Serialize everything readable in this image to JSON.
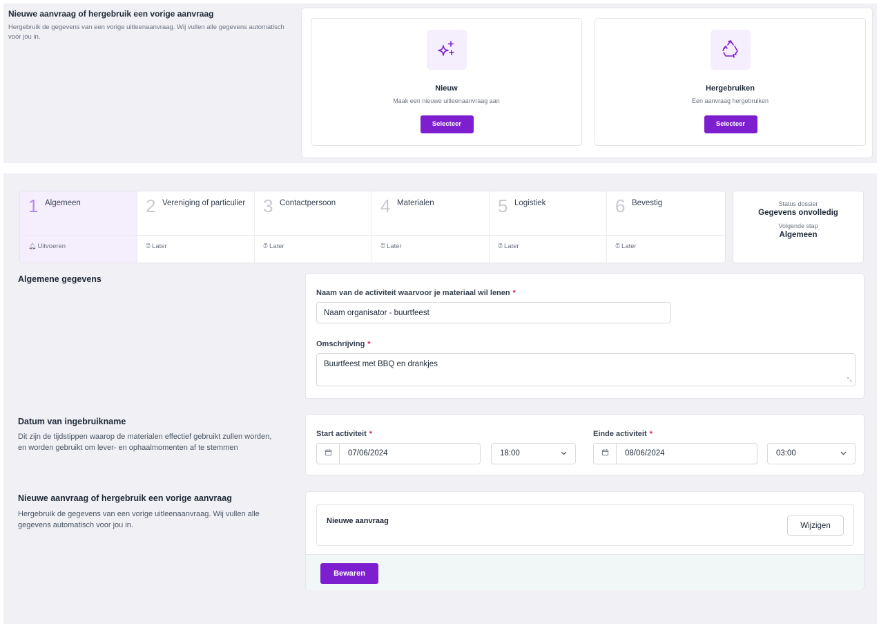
{
  "top": {
    "title": "Nieuwe aanvraag of hergebruik een vorige aanvraag",
    "description": "Hergebruik de gegevens van een vorige uitleenaanvraag. Wij vullen alle gegevens automatisch voor jou in.",
    "choices": [
      {
        "icon": "sparkles-icon",
        "title": "Nieuw",
        "subtitle": "Maak een nieuwe uitleenaanvraag aan",
        "button": "Selecteer"
      },
      {
        "icon": "recycle-icon",
        "title": "Hergebruiken",
        "subtitle": "Een aanvraag hergebruiken",
        "button": "Selecteer"
      }
    ]
  },
  "stepper": {
    "steps": [
      {
        "num": "1",
        "label": "Algemeen",
        "state": "Uitvoeren",
        "state_icon": "bell-icon",
        "active": true
      },
      {
        "num": "2",
        "label": "Vereniging of particulier",
        "state": "Later",
        "state_icon": "alarm-icon",
        "active": false
      },
      {
        "num": "3",
        "label": "Contactpersoon",
        "state": "Later",
        "state_icon": "alarm-icon",
        "active": false
      },
      {
        "num": "4",
        "label": "Materialen",
        "state": "Later",
        "state_icon": "alarm-icon",
        "active": false
      },
      {
        "num": "5",
        "label": "Logistiek",
        "state": "Later",
        "state_icon": "alarm-icon",
        "active": false
      },
      {
        "num": "6",
        "label": "Bevestig",
        "state": "Later",
        "state_icon": "alarm-icon",
        "active": false
      }
    ]
  },
  "status": {
    "label": "Status dossier",
    "value": "Gegevens onvolledig",
    "next_label": "Volgende stap",
    "next_value": "Algemeen"
  },
  "general": {
    "title": "Algemene gegevens",
    "name_label": "Naam van de activiteit waarvoor je materiaal wil lenen",
    "name_value": "Naam organisator - buurtfeest",
    "desc_label": "Omschrijving",
    "desc_value": "Buurtfeest met BBQ en drankjes",
    "required_mark": "*"
  },
  "dates": {
    "title": "Datum van ingebruikname",
    "description": "Dit zijn de tijdstippen waarop de materialen effectief gebruikt zullen worden, en worden gebruikt om lever- en ophaalmomenten af te stemmen",
    "start_label": "Start activiteit",
    "start_date": "07/06/2024",
    "start_time": "18:00",
    "end_label": "Einde activiteit",
    "end_date": "08/06/2024",
    "end_time": "03:00",
    "required_mark": "*"
  },
  "reuse": {
    "title": "Nieuwe aanvraag of hergebruik een vorige aanvraag",
    "description": "Hergebruik de gegevens van een vorige uitleenaanvraag. Wij vullen alle gegevens automatisch voor jou in.",
    "selected": "Nieuwe aanvraag",
    "change_button": "Wijzigen",
    "save_button": "Bewaren"
  },
  "colors": {
    "accent": "#7d1fcf",
    "panel_bg": "#f0f0f5",
    "required": "#e11d48"
  }
}
